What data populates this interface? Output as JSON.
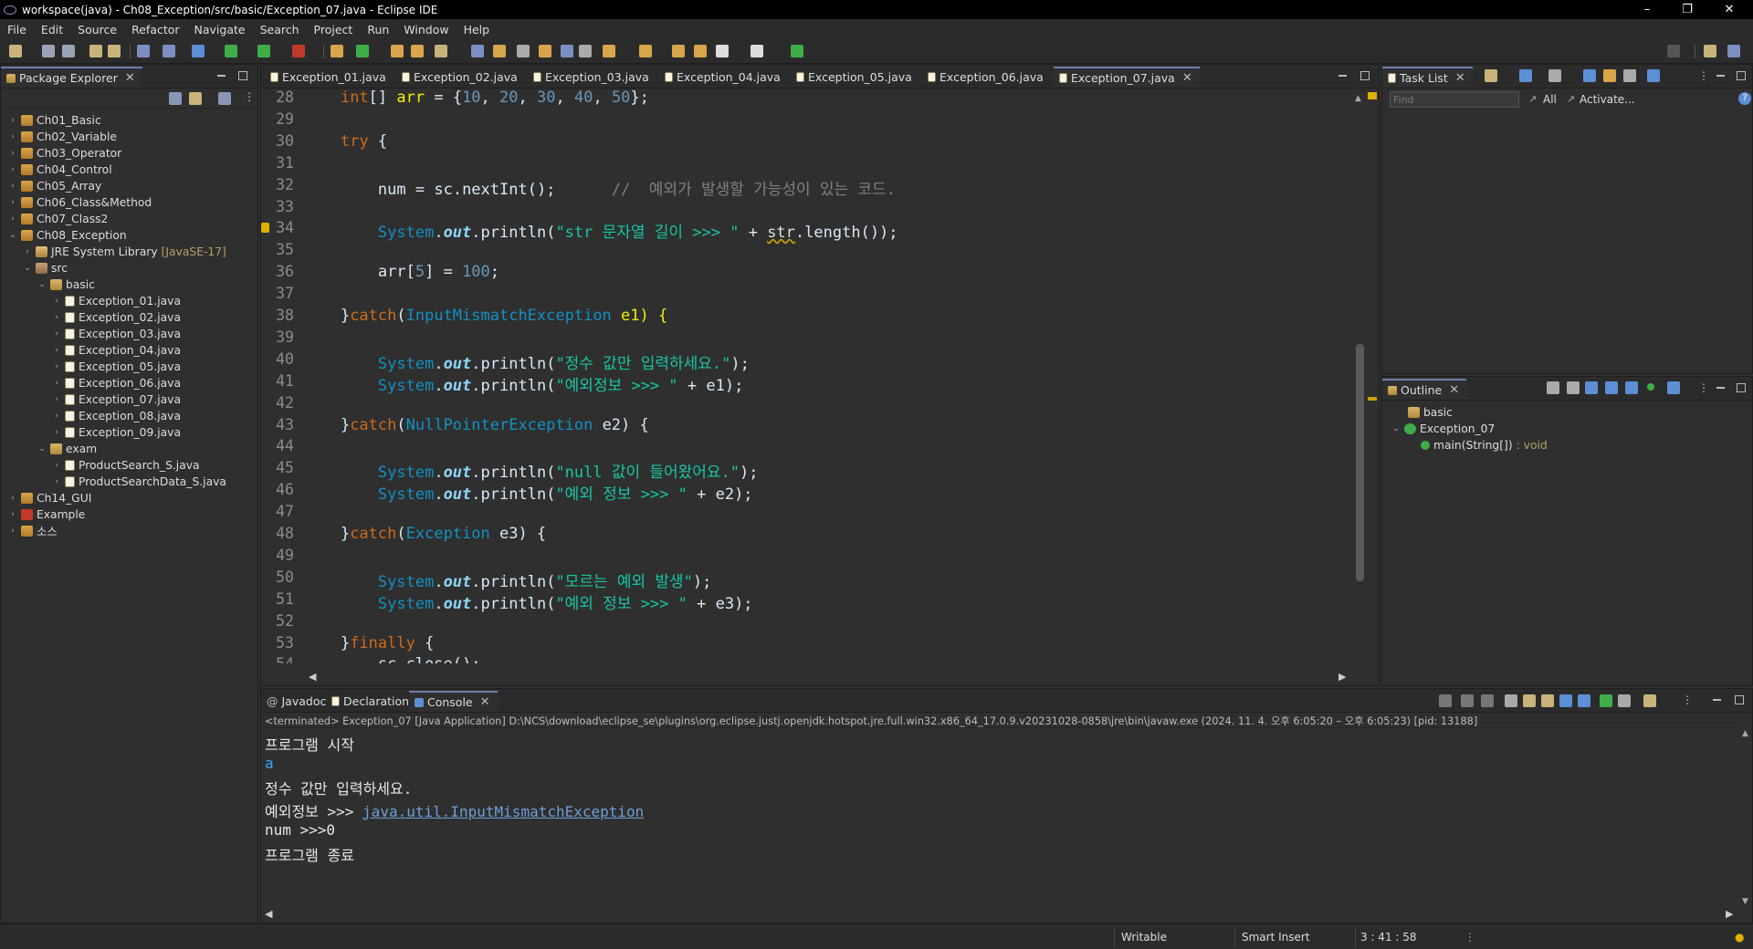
{
  "window": {
    "title": "workspace(java) - Ch08_Exception/src/basic/Exception_07.java - Eclipse IDE",
    "controls": [
      "–",
      "❐",
      "✕"
    ]
  },
  "menu": [
    "File",
    "Edit",
    "Source",
    "Refactor",
    "Navigate",
    "Search",
    "Project",
    "Run",
    "Window",
    "Help"
  ],
  "package_explorer": {
    "title": "Package Explorer",
    "items": [
      {
        "label": "Ch01_Basic",
        "kind": "proj",
        "indent": 0,
        "tw": "›"
      },
      {
        "label": "Ch02_Variable",
        "kind": "proj",
        "indent": 0,
        "tw": "›"
      },
      {
        "label": "Ch03_Operator",
        "kind": "proj",
        "indent": 0,
        "tw": "›"
      },
      {
        "label": "Ch04_Control",
        "kind": "proj",
        "indent": 0,
        "tw": "›"
      },
      {
        "label": "Ch05_Array",
        "kind": "proj",
        "indent": 0,
        "tw": "›"
      },
      {
        "label": "Ch06_Class&Method",
        "kind": "proj",
        "indent": 0,
        "tw": "›"
      },
      {
        "label": "Ch07_Class2",
        "kind": "proj",
        "indent": 0,
        "tw": "›"
      },
      {
        "label": "Ch08_Exception",
        "kind": "proj",
        "indent": 0,
        "tw": "⌄"
      },
      {
        "label": "JRE System Library",
        "suffix": "[JavaSE-17]",
        "kind": "lib",
        "indent": 1,
        "tw": "›"
      },
      {
        "label": "src",
        "kind": "src",
        "indent": 1,
        "tw": "⌄"
      },
      {
        "label": "basic",
        "kind": "pkg",
        "indent": 2,
        "tw": "⌄"
      },
      {
        "label": "Exception_01.java",
        "kind": "java",
        "indent": 3,
        "tw": "›"
      },
      {
        "label": "Exception_02.java",
        "kind": "java",
        "indent": 3,
        "tw": "›"
      },
      {
        "label": "Exception_03.java",
        "kind": "java",
        "indent": 3,
        "tw": "›"
      },
      {
        "label": "Exception_04.java",
        "kind": "java",
        "indent": 3,
        "tw": "›"
      },
      {
        "label": "Exception_05.java",
        "kind": "java",
        "indent": 3,
        "tw": "›"
      },
      {
        "label": "Exception_06.java",
        "kind": "java",
        "indent": 3,
        "tw": "›"
      },
      {
        "label": "Exception_07.java",
        "kind": "java",
        "indent": 3,
        "tw": "›"
      },
      {
        "label": "Exception_08.java",
        "kind": "java",
        "indent": 3,
        "tw": "›"
      },
      {
        "label": "Exception_09.java",
        "kind": "java",
        "indent": 3,
        "tw": "›"
      },
      {
        "label": "exam",
        "kind": "pkg",
        "indent": 2,
        "tw": "⌄"
      },
      {
        "label": "ProductSearch_S.java",
        "kind": "java",
        "indent": 3,
        "tw": "›"
      },
      {
        "label": "ProductSearchData_S.java",
        "kind": "java",
        "indent": 3,
        "tw": "›"
      },
      {
        "label": "Ch14_GUI",
        "kind": "proj",
        "indent": 0,
        "tw": "›"
      },
      {
        "label": "Example",
        "kind": "err",
        "indent": 0,
        "tw": "›"
      },
      {
        "label": "소스",
        "kind": "proj",
        "indent": 0,
        "tw": "›"
      }
    ]
  },
  "editor": {
    "tabs": [
      "Exception_01.java",
      "Exception_02.java",
      "Exception_03.java",
      "Exception_04.java",
      "Exception_05.java",
      "Exception_06.java",
      "Exception_07.java"
    ],
    "active_tab": "Exception_07.java",
    "lines": [
      {
        "n": "28",
        "segs": [
          [
            "    ",
            "plain"
          ],
          [
            "int",
            "kw"
          ],
          [
            "[] ",
            "plain"
          ],
          [
            "arr",
            "var"
          ],
          [
            " = {",
            "plain"
          ],
          [
            "10",
            "num"
          ],
          [
            ", ",
            "plain"
          ],
          [
            "20",
            "num"
          ],
          [
            ", ",
            "plain"
          ],
          [
            "30",
            "num"
          ],
          [
            ", ",
            "plain"
          ],
          [
            "40",
            "num"
          ],
          [
            ", ",
            "plain"
          ],
          [
            "50",
            "num"
          ],
          [
            "};",
            "plain"
          ]
        ]
      },
      {
        "n": "29",
        "segs": []
      },
      {
        "n": "30",
        "segs": [
          [
            "    ",
            "plain"
          ],
          [
            "try",
            "kw"
          ],
          [
            " {",
            "plain"
          ]
        ]
      },
      {
        "n": "31",
        "segs": []
      },
      {
        "n": "32",
        "segs": [
          [
            "        ",
            "plain"
          ],
          [
            "num",
            "plain"
          ],
          [
            " = ",
            "plain"
          ],
          [
            "sc",
            "plain"
          ],
          [
            ".",
            "plain"
          ],
          [
            "nextInt",
            "plain"
          ],
          [
            "();      ",
            "plain"
          ],
          [
            "//  예외가 발생할 가능성이 있는 코드.",
            "cmt"
          ]
        ]
      },
      {
        "n": "33",
        "segs": []
      },
      {
        "n": "34",
        "segs": [
          [
            "        ",
            "plain"
          ],
          [
            "System",
            "ty"
          ],
          [
            ".",
            "plain"
          ],
          [
            "out",
            "fld"
          ],
          [
            ".",
            "plain"
          ],
          [
            "println",
            "plain"
          ],
          [
            "(",
            "plain"
          ],
          [
            "\"str 문자열 길이 >>> \"",
            "str"
          ],
          [
            " + ",
            "plain"
          ],
          [
            "str",
            "ul"
          ],
          [
            ".",
            "plain"
          ],
          [
            "length",
            "plain"
          ],
          [
            "());",
            "plain"
          ]
        ]
      },
      {
        "n": "35",
        "segs": []
      },
      {
        "n": "36",
        "segs": [
          [
            "        ",
            "plain"
          ],
          [
            "arr",
            "plain"
          ],
          [
            "[",
            "plain"
          ],
          [
            "5",
            "num"
          ],
          [
            "] = ",
            "plain"
          ],
          [
            "100",
            "num"
          ],
          [
            ";",
            "plain"
          ]
        ]
      },
      {
        "n": "37",
        "segs": []
      },
      {
        "n": "38",
        "segs": [
          [
            "    }",
            "plain"
          ],
          [
            "catch",
            "kw"
          ],
          [
            "(",
            "plain"
          ],
          [
            "InputMismatchException",
            "ty"
          ],
          [
            " e1) {",
            "var"
          ]
        ]
      },
      {
        "n": "39",
        "segs": []
      },
      {
        "n": "40",
        "segs": [
          [
            "        ",
            "plain"
          ],
          [
            "System",
            "ty"
          ],
          [
            ".",
            "plain"
          ],
          [
            "out",
            "fld"
          ],
          [
            ".",
            "plain"
          ],
          [
            "println",
            "plain"
          ],
          [
            "(",
            "plain"
          ],
          [
            "\"정수 값만 입력하세요.\"",
            "str"
          ],
          [
            ");",
            "plain"
          ]
        ]
      },
      {
        "n": "41",
        "segs": [
          [
            "        ",
            "plain"
          ],
          [
            "System",
            "ty"
          ],
          [
            ".",
            "plain"
          ],
          [
            "out",
            "fld"
          ],
          [
            ".",
            "plain"
          ],
          [
            "println",
            "plain"
          ],
          [
            "(",
            "plain"
          ],
          [
            "\"예외정보 >>> \"",
            "str"
          ],
          [
            " + e1);",
            "plain"
          ]
        ]
      },
      {
        "n": "42",
        "segs": []
      },
      {
        "n": "43",
        "segs": [
          [
            "    }",
            "plain"
          ],
          [
            "catch",
            "kw"
          ],
          [
            "(",
            "plain"
          ],
          [
            "NullPointerException",
            "ty"
          ],
          [
            " e2) {",
            "plain"
          ]
        ]
      },
      {
        "n": "44",
        "segs": []
      },
      {
        "n": "45",
        "segs": [
          [
            "        ",
            "plain"
          ],
          [
            "System",
            "ty"
          ],
          [
            ".",
            "plain"
          ],
          [
            "out",
            "fld"
          ],
          [
            ".",
            "plain"
          ],
          [
            "println",
            "plain"
          ],
          [
            "(",
            "plain"
          ],
          [
            "\"null 값이 들어왔어요.\"",
            "str"
          ],
          [
            ");",
            "plain"
          ]
        ]
      },
      {
        "n": "46",
        "segs": [
          [
            "        ",
            "plain"
          ],
          [
            "System",
            "ty"
          ],
          [
            ".",
            "plain"
          ],
          [
            "out",
            "fld"
          ],
          [
            ".",
            "plain"
          ],
          [
            "println",
            "plain"
          ],
          [
            "(",
            "plain"
          ],
          [
            "\"예외 정보 >>> \"",
            "str"
          ],
          [
            " + e2);",
            "plain"
          ]
        ]
      },
      {
        "n": "47",
        "segs": []
      },
      {
        "n": "48",
        "segs": [
          [
            "    }",
            "plain"
          ],
          [
            "catch",
            "kw"
          ],
          [
            "(",
            "plain"
          ],
          [
            "Exception",
            "ty"
          ],
          [
            " e3) {",
            "plain"
          ]
        ]
      },
      {
        "n": "49",
        "segs": []
      },
      {
        "n": "50",
        "segs": [
          [
            "        ",
            "plain"
          ],
          [
            "System",
            "ty"
          ],
          [
            ".",
            "plain"
          ],
          [
            "out",
            "fld"
          ],
          [
            ".",
            "plain"
          ],
          [
            "println",
            "plain"
          ],
          [
            "(",
            "plain"
          ],
          [
            "\"모르는 예외 발생\"",
            "str"
          ],
          [
            ");",
            "plain"
          ]
        ]
      },
      {
        "n": "51",
        "segs": [
          [
            "        ",
            "plain"
          ],
          [
            "System",
            "ty"
          ],
          [
            ".",
            "plain"
          ],
          [
            "out",
            "fld"
          ],
          [
            ".",
            "plain"
          ],
          [
            "println",
            "plain"
          ],
          [
            "(",
            "plain"
          ],
          [
            "\"예외 정보 >>> \"",
            "str"
          ],
          [
            " + e3);",
            "plain"
          ]
        ]
      },
      {
        "n": "52",
        "segs": []
      },
      {
        "n": "53",
        "segs": [
          [
            "    }",
            "plain"
          ],
          [
            "finally",
            "kw"
          ],
          [
            " {",
            "plain"
          ]
        ]
      },
      {
        "n": "54",
        "segs": [
          [
            "        ",
            "plain"
          ],
          [
            "sc.close();",
            "plain"
          ]
        ]
      }
    ]
  },
  "task_list": {
    "title": "Task List",
    "find_placeholder": "Find",
    "all_label": "All",
    "activate_label": "Activate..."
  },
  "outline": {
    "title": "Outline",
    "items": [
      {
        "label": "basic",
        "indent": 0
      },
      {
        "label": "Exception_07",
        "indent": 0
      },
      {
        "label": "main(String[])",
        "suffix": ": void",
        "indent": 1
      }
    ]
  },
  "bottom_panel": {
    "tabs": [
      "Javadoc",
      "Declaration",
      "Console"
    ],
    "active_tab": "Console",
    "terminated": "<terminated> Exception_07 [Java Application] D:\\NCS\\download\\eclipse_se\\plugins\\org.eclipse.justj.openjdk.hotspot.jre.full.win32.x86_64_17.0.9.v20231028-0858\\jre\\bin\\javaw.exe  (2024. 11. 4. 오후 6:05:20 – 오후 6:05:23) [pid: 13188]",
    "output": [
      {
        "text": "프로그램 시작",
        "style": "out"
      },
      {
        "text": "a",
        "style": "input"
      },
      {
        "text": "정수 값만 입력하세요.",
        "style": "out"
      },
      {
        "text": "예외정보 >>> ",
        "link": "java.util.InputMismatchException",
        "style": "out"
      },
      {
        "text": "num >>>0",
        "style": "out"
      },
      {
        "text": "프로그램 종료",
        "style": "out"
      }
    ]
  },
  "status": {
    "writable": "Writable",
    "insert_mode": "Smart Insert",
    "position": "3 : 41 : 58"
  },
  "colors": {
    "keyword": "#cc6c1d",
    "type": "#1290c3",
    "string": "#17c6a3",
    "number": "#6897bb",
    "comment": "#808080",
    "background": "#2f2f2f"
  }
}
